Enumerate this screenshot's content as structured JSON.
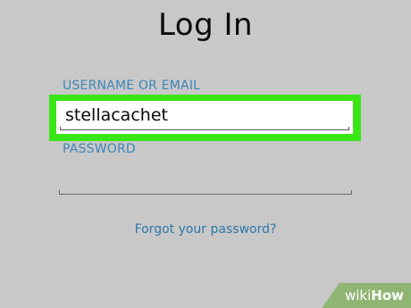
{
  "screen": {
    "title": "Log In"
  },
  "form": {
    "username": {
      "label": "USERNAME OR EMAIL",
      "value": "stellacachet",
      "highlight_color": "#39e615"
    },
    "password": {
      "label": "PASSWORD",
      "value": ""
    },
    "forgot_link": "Forgot your password?"
  },
  "colors": {
    "background": "#c8c8c8",
    "label": "#3d86b7",
    "link": "#2d77a8"
  },
  "watermark": {
    "part1": "wiki",
    "part2": "How"
  }
}
